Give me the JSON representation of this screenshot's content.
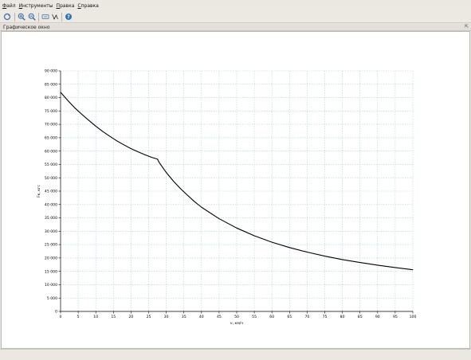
{
  "menu": {
    "items": [
      "Файл",
      "Инструменты",
      "Правка",
      "Справка"
    ]
  },
  "toolbar": {
    "icons": [
      "rotate-icon",
      "zoom-in-icon",
      "zoom-out-icon",
      "pan-icon",
      "data-tip-icon",
      "help-icon"
    ]
  },
  "panel": {
    "title": "Графическое окно",
    "undock_glyph": "⇱"
  },
  "colors": {
    "curve": "#000000",
    "grid": "#a8d4e8",
    "help_icon": "#2d6fb8"
  },
  "chart_data": {
    "type": "line",
    "xlabel": "v, км/ч",
    "ylabel": "Fк, кгс",
    "xlim": [
      0,
      100
    ],
    "ylim": [
      0,
      90000
    ],
    "xticks": [
      "0",
      "5",
      "10",
      "15",
      "20",
      "25",
      "30",
      "35",
      "40",
      "45",
      "50",
      "55",
      "60",
      "65",
      "70",
      "75",
      "80",
      "85",
      "90",
      "95",
      "100"
    ],
    "yticks": [
      "0",
      "5 000",
      "10 000",
      "15 000",
      "20 000",
      "25 000",
      "30 000",
      "35 000",
      "40 000",
      "45 000",
      "50 000",
      "55 000",
      "60 000",
      "65 000",
      "70 000",
      "75 000",
      "80 000",
      "85 000",
      "90 000"
    ],
    "grid": true,
    "series": [
      {
        "x": [
          0,
          2,
          4,
          6,
          8,
          10,
          12,
          14,
          16,
          18,
          20,
          22,
          24,
          26,
          27.5,
          28,
          30,
          32,
          34,
          36,
          38,
          40,
          45,
          50,
          55,
          60,
          65,
          70,
          75,
          80,
          85,
          90,
          95,
          100
        ],
        "values": [
          82000,
          79000,
          76200,
          73800,
          71500,
          69300,
          67300,
          65500,
          63800,
          62300,
          60900,
          59700,
          58600,
          57600,
          57000,
          55700,
          52000,
          48800,
          46000,
          43500,
          41100,
          39000,
          34700,
          31200,
          28300,
          25900,
          23900,
          22200,
          20700,
          19400,
          18300,
          17300,
          16400,
          15600
        ]
      }
    ]
  }
}
